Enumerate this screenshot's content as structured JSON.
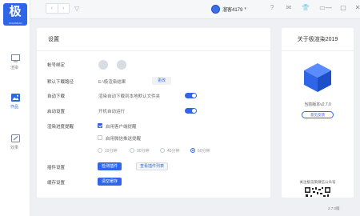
{
  "logo": {
    "text": "极",
    "subtext": "JIXUANRAN"
  },
  "rail": [
    {
      "label": "渲染",
      "icon": "monitor-icon",
      "active": false
    },
    {
      "label": "作品",
      "icon": "image-icon",
      "active": true
    },
    {
      "label": "效果",
      "icon": "brush-icon",
      "active": false
    }
  ],
  "topbar": {
    "back": "‹",
    "forward": "›",
    "filter": "▽",
    "user_name": "溜客4179",
    "user_caret": "▾",
    "tools": [
      "?",
      "✉",
      "👕",
      "▭"
    ],
    "window": [
      "—",
      "▢",
      "✕"
    ]
  },
  "settings": {
    "title": "设置",
    "rows": {
      "account_label": "帐号绑定",
      "download_label": "默认下载路径",
      "download_path": "E:\\极渲染结果",
      "change_btn": "更改",
      "auto_download_label": "自动下载",
      "auto_download_text": "渲染自动下载到本地默认文件夹",
      "startup_label": "启动设置",
      "startup_text": "开机自动运行",
      "reminder_label": "渲染进度提醒",
      "reminder_opt1": "启用客户端提醒",
      "reminder_opt2": "启用微信推送提醒",
      "intervals": [
        "15分钟",
        "30分钟",
        "45分钟",
        "60分钟"
      ],
      "plugin_label": "插件设置",
      "plugin_detect_btn": "检测插件",
      "plugin_list_btn": "查看插件列表",
      "cache_label": "缓存设置",
      "cache_clear_btn": "清空缓存"
    },
    "state": {
      "auto_download": true,
      "startup": true,
      "client_reminder": true,
      "wechat_reminder": false,
      "selected_interval": "60分钟"
    }
  },
  "about": {
    "title": "关于极渲染2019",
    "version": "当前版本v2.7.0",
    "feedback_btn": "意见反馈",
    "wechat": "关注极渲染微信公众号"
  },
  "footer_version": "2.7.0版"
}
